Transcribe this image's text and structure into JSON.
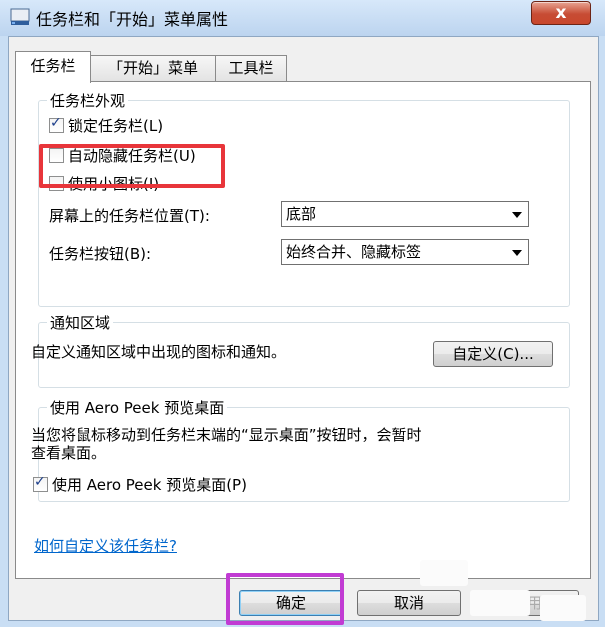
{
  "window": {
    "title": "任务栏和「开始」菜单属性",
    "close_label": "x"
  },
  "tabs": [
    {
      "label": "任务栏",
      "active": true
    },
    {
      "label": "「开始」菜单",
      "active": false
    },
    {
      "label": "工具栏",
      "active": false
    }
  ],
  "appearance": {
    "title": "任务栏外观",
    "lock_label": "锁定任务栏(L)",
    "lock_checked": true,
    "autohide_label": "自动隐藏任务栏(U)",
    "autohide_checked": false,
    "small_icons_label": "使用小图标(I)",
    "small_icons_checked": false,
    "position_label": "屏幕上的任务栏位置(T):",
    "position_value": "底部",
    "buttons_label": "任务栏按钮(B):",
    "buttons_value": "始终合并、隐藏标签"
  },
  "notification": {
    "title": "通知区域",
    "description": "自定义通知区域中出现的图标和通知。",
    "customize_button": "自定义(C)..."
  },
  "aero_peek": {
    "title": "使用 Aero Peek 预览桌面",
    "description_line1": "当您将鼠标移动到任务栏末端的“显示桌面”按钮时，会暂时",
    "description_line2": "查看桌面。",
    "checkbox_label": "使用 Aero Peek 预览桌面(P)",
    "checked": true
  },
  "help_link": "如何自定义该任务栏?",
  "footer": {
    "ok_button": "确定",
    "cancel_button": "取消",
    "apply_button": "应用"
  },
  "colors": {
    "red_highlight": "#e8353a",
    "purple_highlight": "#c13bd3",
    "link": "#0066cc"
  }
}
